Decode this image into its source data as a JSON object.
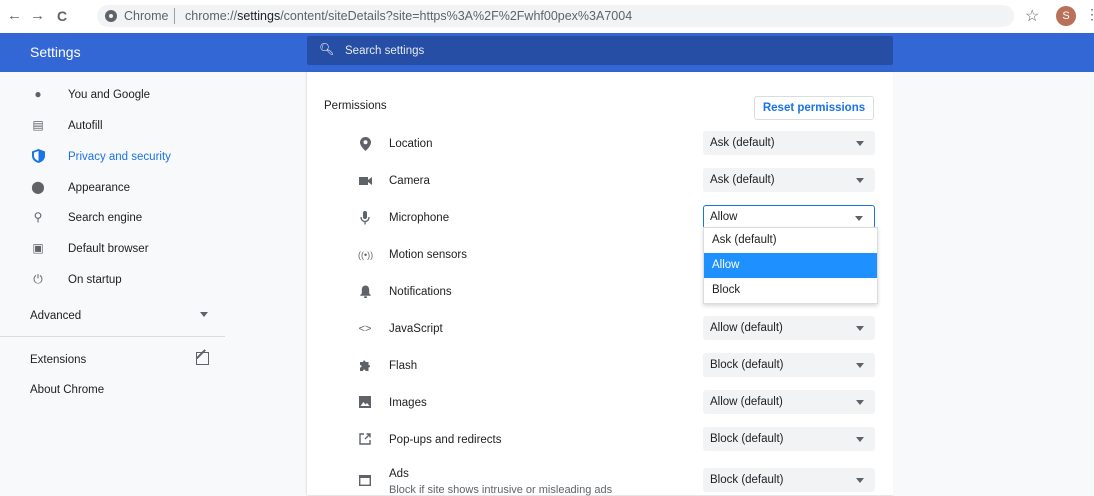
{
  "browser": {
    "back_glyph": "←",
    "forward_glyph": "→",
    "reload_glyph": "C",
    "chip_label": "Chrome",
    "url_prefix": "chrome://",
    "url_bold": "settings",
    "url_rest": "/content/siteDetails?site=https%3A%2F%2Fwhf00pex%3A7004",
    "star_glyph": "☆",
    "avatar_letter": "S",
    "menu_glyph": "⋮"
  },
  "header": {
    "title": "Settings",
    "search_placeholder": "Search settings",
    "color": "#3367d6"
  },
  "sidebar": {
    "items": [
      {
        "label": "You and Google",
        "icon": "person-icon",
        "active": false
      },
      {
        "label": "Autofill",
        "icon": "clipboard-icon",
        "active": false
      },
      {
        "label": "Privacy and security",
        "icon": "shield-icon",
        "active": true
      },
      {
        "label": "Appearance",
        "icon": "palette-icon",
        "active": false
      },
      {
        "label": "Search engine",
        "icon": "search-icon",
        "active": false
      },
      {
        "label": "Default browser",
        "icon": "browser-icon",
        "active": false
      },
      {
        "label": "On startup",
        "icon": "power-icon",
        "active": false
      }
    ],
    "advanced_label": "Advanced",
    "extensions_label": "Extensions",
    "about_label": "About Chrome",
    "active_color": "#1a73e8"
  },
  "permissions": {
    "title": "Permissions",
    "reset_label": "Reset permissions",
    "rows": [
      {
        "label": "Location",
        "icon": "location-pin-icon",
        "value": "Ask (default)"
      },
      {
        "label": "Camera",
        "icon": "camera-icon",
        "value": "Ask (default)"
      },
      {
        "label": "Microphone",
        "icon": "microphone-icon",
        "value": "Allow"
      },
      {
        "label": "Motion sensors",
        "icon": "motion-sensors-icon",
        "value": ""
      },
      {
        "label": "Notifications",
        "icon": "bell-icon",
        "value": ""
      },
      {
        "label": "JavaScript",
        "icon": "code-icon",
        "value": "Allow (default)"
      },
      {
        "label": "Flash",
        "icon": "puzzle-icon",
        "value": "Block (default)"
      },
      {
        "label": "Images",
        "icon": "image-icon",
        "value": "Allow (default)"
      },
      {
        "label": "Pop-ups and redirects",
        "icon": "popup-icon",
        "value": "Block (default)"
      },
      {
        "label": "Ads",
        "sublabel": "Block if site shows intrusive or misleading ads",
        "icon": "ads-icon",
        "value": "Block (default)"
      }
    ],
    "dropdown_options": [
      "Ask (default)",
      "Allow",
      "Block"
    ],
    "dropdown_selected": "Allow",
    "highlight_color": "#1e90ff"
  }
}
